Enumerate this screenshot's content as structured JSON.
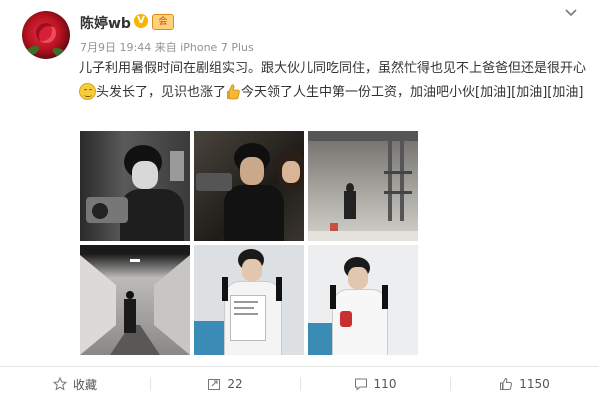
{
  "post": {
    "author": "陈婷wb",
    "verified_badge": "V",
    "member_badge": "会",
    "date": "7月9日",
    "time": "19:44",
    "source": "来自 iPhone 7 Plus",
    "text_1": "儿子利用暑假时间在剧组实习。跟大伙儿同吃同住，虽然忙得也见不上爸爸但还是很开心",
    "text_2": "头发长了，见识也涨了",
    "text_3": "今天领了人生中第一份工资，加油吧小伙[加油][加油][加油]"
  },
  "photos": [
    {
      "subject": "young man with camera, black and white"
    },
    {
      "subject": "young man filming on set"
    },
    {
      "subject": "studio set"
    },
    {
      "subject": "corridor"
    },
    {
      "subject": "young man holding paper"
    },
    {
      "subject": "young man smiling"
    }
  ],
  "actions": {
    "favorite": "收藏",
    "repost": "22",
    "comment": "110",
    "like": "1150"
  },
  "colors": {
    "accent_badge": "#f7b500",
    "text": "#333333",
    "meta": "#939393"
  }
}
